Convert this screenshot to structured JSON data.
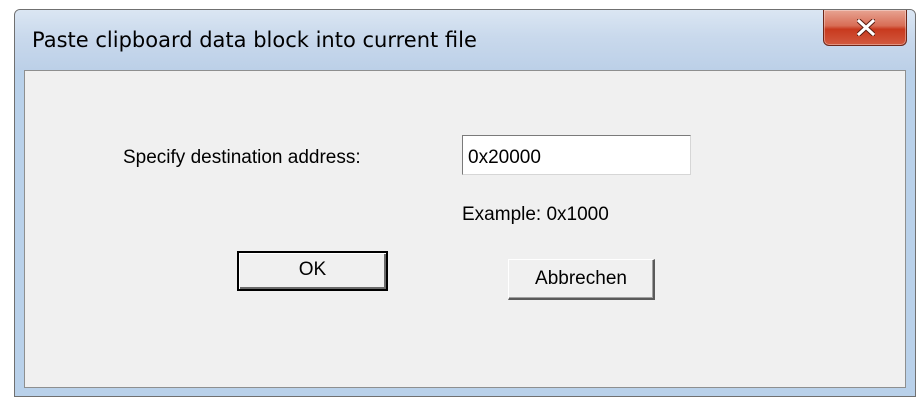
{
  "dialog": {
    "title": "Paste clipboard data block into current file",
    "close_icon": "close-x-icon"
  },
  "form": {
    "destination_label": "Specify destination address:",
    "address_value": "0x20000",
    "example_text": "Example:  0x1000"
  },
  "buttons": {
    "ok_label": "OK",
    "cancel_label": "Abbrechen"
  },
  "colors": {
    "close_button": "#c8391e",
    "titlebar": "#c9d9ec",
    "dialog_background": "#f0f0f0"
  }
}
